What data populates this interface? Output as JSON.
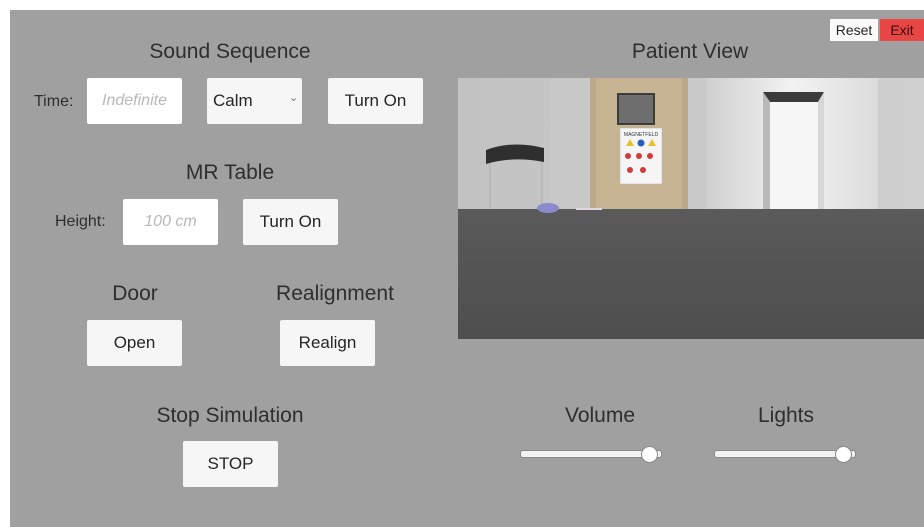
{
  "top_right": {
    "reset_label": "Reset",
    "exit_label": "Exit",
    "exit_color": "#e84545"
  },
  "sound": {
    "title": "Sound Sequence",
    "time_label": "Time:",
    "time_placeholder": "Indefinite",
    "mode_value": "Calm",
    "turn_on_label": "Turn On"
  },
  "mr_table": {
    "title": "MR Table",
    "height_label": "Height:",
    "height_placeholder": "100 cm",
    "turn_on_label": "Turn On"
  },
  "door": {
    "title": "Door",
    "open_label": "Open"
  },
  "realignment": {
    "title": "Realignment",
    "realign_label": "Realign"
  },
  "stop": {
    "title": "Stop Simulation",
    "stop_label": "STOP"
  },
  "patient_view": {
    "title": "Patient View",
    "sign_text": "MAGNETFELD"
  },
  "volume": {
    "label": "Volume",
    "level": 0.94
  },
  "lights": {
    "label": "Lights",
    "level": 0.94
  }
}
